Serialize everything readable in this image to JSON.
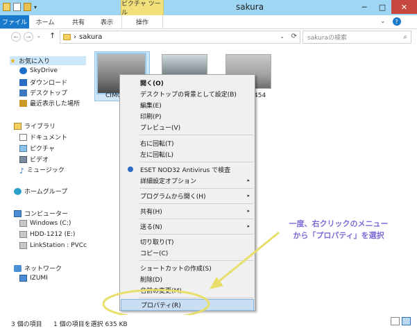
{
  "window": {
    "title": "sakura",
    "minimize": "─",
    "maximize": "□",
    "close": "✕"
  },
  "contextual_tab_header": "ピクチャ ツール",
  "ribbon": {
    "tabs": [
      "ファイル",
      "ホーム",
      "共有",
      "表示",
      "操作"
    ],
    "help_chevron": "⌄",
    "help_icon": "?"
  },
  "nav": {
    "back": "←",
    "forward": "→",
    "recent": "⌄",
    "up": "↑",
    "address_sep": "›",
    "address": "sakura",
    "address_chevron": "⌄",
    "refresh": "⟳",
    "search_placeholder": "sakuraの検索",
    "search_icon": "⌕"
  },
  "navpane": {
    "favorites": {
      "title": "お気に入り",
      "items": [
        "SkyDrive",
        "ダウンロード",
        "デスクトップ",
        "最近表示した場所"
      ]
    },
    "libraries": {
      "title": "ライブラリ",
      "items": [
        "ドキュメント",
        "ピクチャ",
        "ビデオ",
        "ミュージック"
      ]
    },
    "homegroup": "ホームグループ",
    "computer": {
      "title": "コンピューター",
      "items": [
        "Windows (C:)",
        "HDD-1212 (E:)",
        "LinkStation : PVCc"
      ]
    },
    "network": {
      "title": "ネットワーク",
      "items": [
        "IZUMI"
      ]
    }
  },
  "files": [
    {
      "name": "CIMG",
      "selected": true
    },
    {
      "name": "",
      "selected": false
    },
    {
      "name": "454",
      "selected": false
    }
  ],
  "context_menu": {
    "items": [
      {
        "label": "開く(O)",
        "bold": true
      },
      {
        "label": "デスクトップの背景として設定(B)"
      },
      {
        "label": "編集(E)"
      },
      {
        "label": "印刷(P)"
      },
      {
        "label": "プレビュー(V)"
      },
      {
        "label": "右に回転(T)"
      },
      {
        "label": "左に回転(L)"
      },
      {
        "label": "ESET NOD32 Antivirus で検査",
        "icon": "eset-icon"
      },
      {
        "label": "詳細設定オプション",
        "submenu": true
      },
      {
        "label": "プログラムから開く(H)",
        "submenu": true
      },
      {
        "label": "共有(H)",
        "submenu": true
      },
      {
        "label": "送る(N)",
        "submenu": true
      },
      {
        "label": "切り取り(T)"
      },
      {
        "label": "コピー(C)"
      },
      {
        "label": "ショートカットの作成(S)"
      },
      {
        "label": "削除(D)"
      },
      {
        "label": "名前の変更(M)"
      },
      {
        "label": "プロパティ(R)",
        "highlighted": true
      }
    ],
    "submenu_arrow": "▸"
  },
  "annotation": {
    "line1": "一度、右クリックのメニュー",
    "line2": "から「プロパティ」を選択",
    "color": "#7b6bd6",
    "arrow_color": "#e8de6a"
  },
  "status": {
    "count": "3 個の項目",
    "selection": "1 個の項目を選択  635 KB"
  }
}
